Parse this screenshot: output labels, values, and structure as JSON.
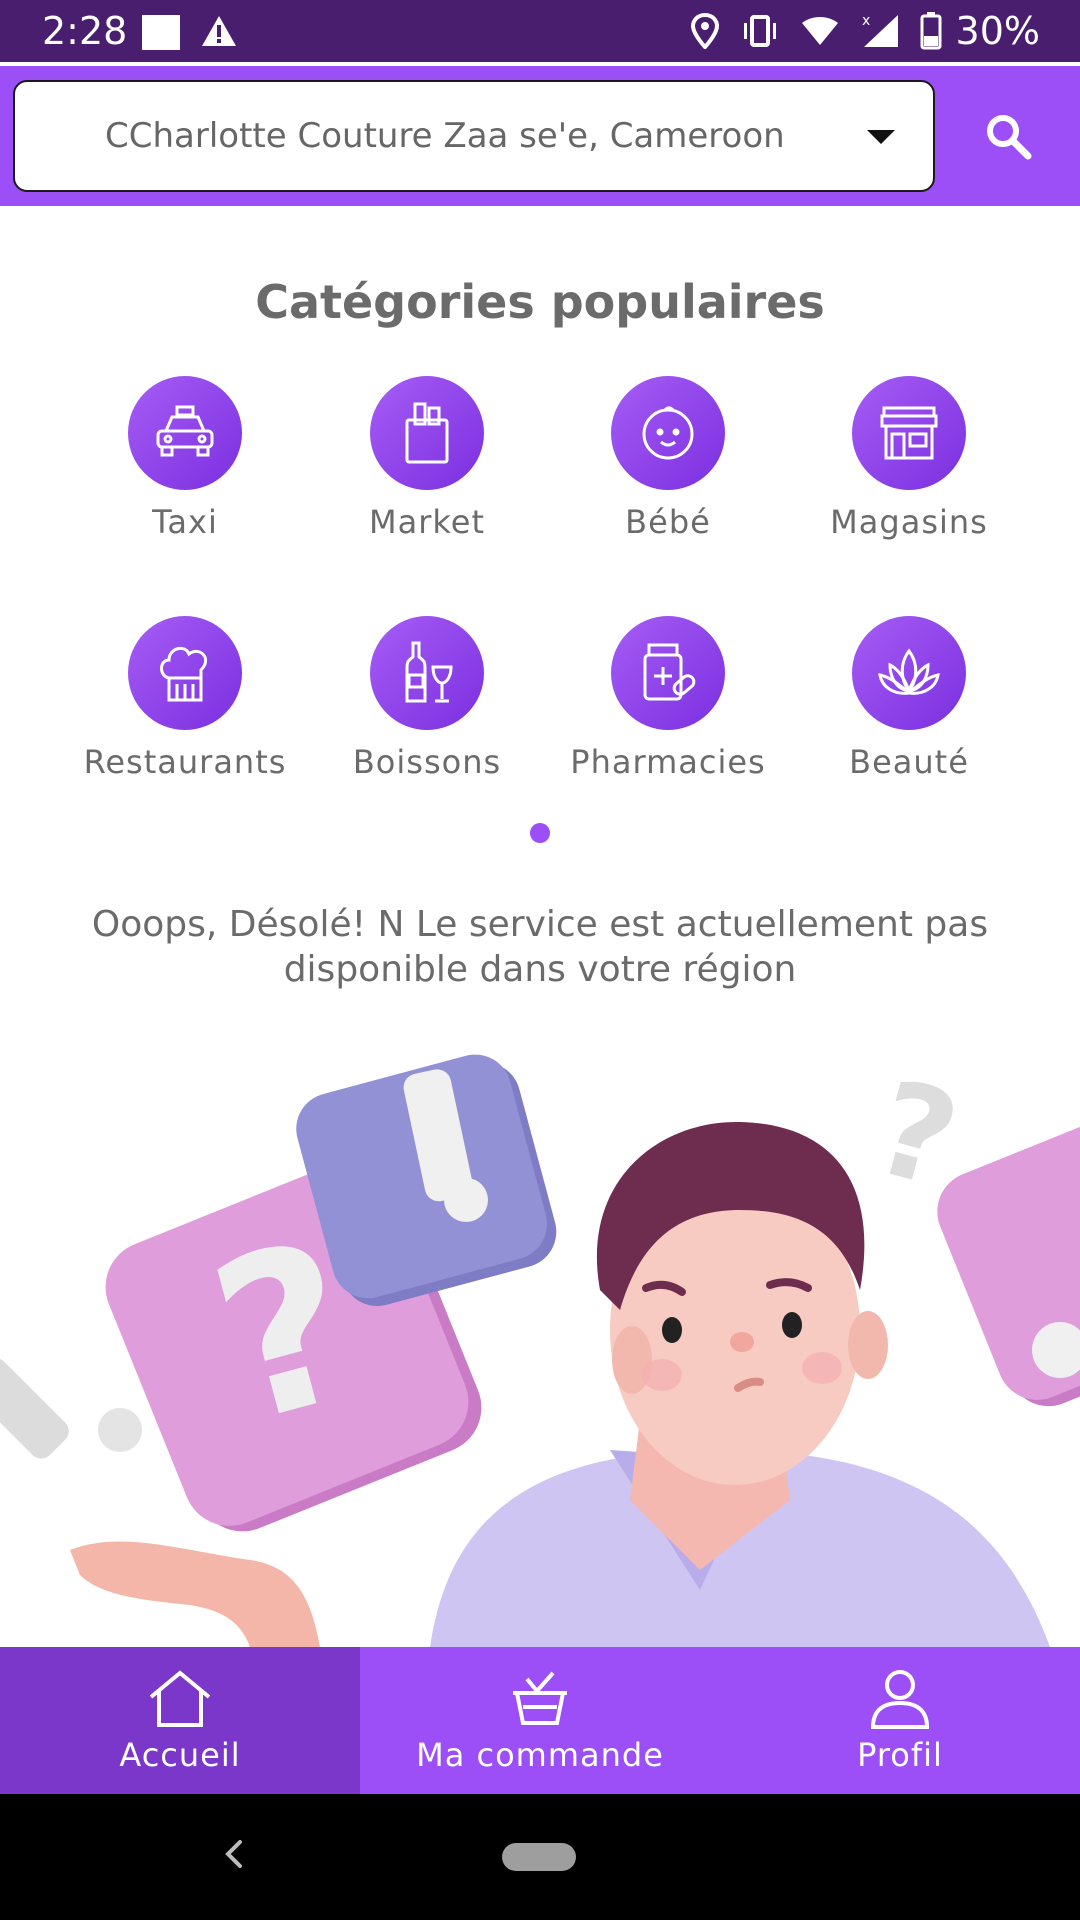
{
  "status_bar": {
    "time": "2:28",
    "battery": "30%",
    "icons": [
      "notification-square-icon",
      "warning-icon",
      "location-icon",
      "vibrate-icon",
      "wifi-icon",
      "signal-icon",
      "battery-icon"
    ]
  },
  "header": {
    "location": "CCharlotte Couture Zaa se'e, Cameroon",
    "search_icon": "search-icon"
  },
  "categories": {
    "title": "Catégories populaires",
    "items": [
      {
        "label": "Taxi",
        "icon": "taxi-icon"
      },
      {
        "label": "Market",
        "icon": "shopping-bag-icon"
      },
      {
        "label": "Bébé",
        "icon": "baby-icon"
      },
      {
        "label": "Magasins",
        "icon": "store-icon"
      },
      {
        "label": "Restaurants",
        "icon": "chef-hat-icon"
      },
      {
        "label": "Boissons",
        "icon": "drinks-icon"
      },
      {
        "label": "Pharmacies",
        "icon": "medicine-icon"
      },
      {
        "label": "Beauté",
        "icon": "lotus-icon"
      }
    ]
  },
  "message": {
    "line1": "Ooops, Désolé!  N Le service est actuellement pas",
    "line2": "disponible dans votre région"
  },
  "bottom_nav": {
    "items": [
      {
        "label": "Accueil",
        "icon": "home-icon",
        "active": true
      },
      {
        "label": "Ma commande",
        "icon": "basket-icon",
        "active": false
      },
      {
        "label": "Profil",
        "icon": "profile-icon",
        "active": false
      }
    ]
  },
  "colors": {
    "primary": "#9d4ff7",
    "status_bar": "#4a1e6e",
    "active_tab": "#7a37c9",
    "text": "#6b6b6b"
  }
}
